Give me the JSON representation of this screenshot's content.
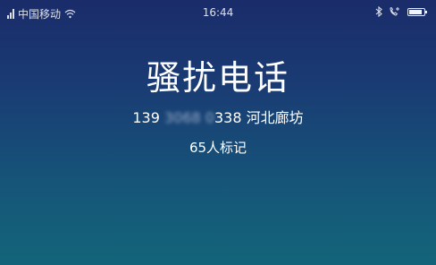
{
  "status_bar": {
    "carrier": "中国移动",
    "time": "16:44",
    "battery_level": 0.85,
    "icons": [
      "signal-icon",
      "wifi-icon",
      "bluetooth-icon",
      "call-icon",
      "battery-icon"
    ]
  },
  "caller": {
    "label": "骚扰电话",
    "number_prefix": "139",
    "number_masked_a": "3068",
    "number_masked_b": "0",
    "number_suffix": "338",
    "location": "河北廊坊",
    "marked_count": "65人标记"
  },
  "colors": {
    "background_top": "#1a2c6a",
    "background_bottom": "#13647a",
    "text": "#ffffff"
  }
}
